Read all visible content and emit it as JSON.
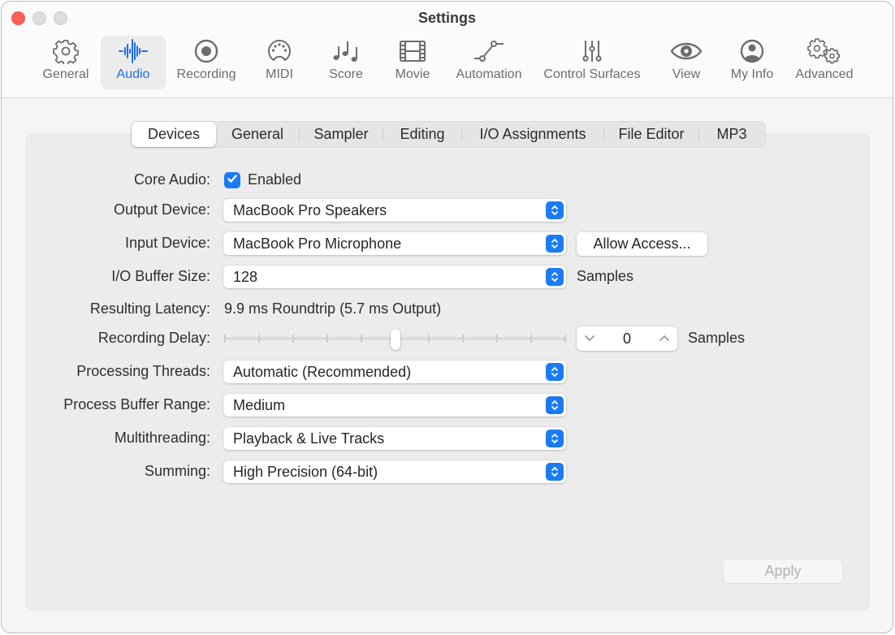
{
  "window": {
    "title": "Settings",
    "traffic_lights": [
      "close",
      "minimize",
      "zoom"
    ]
  },
  "toolbar": {
    "items": [
      {
        "label": "General",
        "icon": "gear-icon",
        "active": false
      },
      {
        "label": "Audio",
        "icon": "waveform-icon",
        "active": true
      },
      {
        "label": "Recording",
        "icon": "record-icon",
        "active": false
      },
      {
        "label": "MIDI",
        "icon": "midi-connector-icon",
        "active": false
      },
      {
        "label": "Score",
        "icon": "music-notes-icon",
        "active": false
      },
      {
        "label": "Movie",
        "icon": "film-icon",
        "active": false
      },
      {
        "label": "Automation",
        "icon": "automation-curve-icon",
        "active": false
      },
      {
        "label": "Control Surfaces",
        "icon": "sliders-icon",
        "active": false
      },
      {
        "label": "View",
        "icon": "eye-icon",
        "active": false
      },
      {
        "label": "My Info",
        "icon": "person-circle-icon",
        "active": false
      },
      {
        "label": "Advanced",
        "icon": "gears-icon",
        "active": false
      }
    ],
    "accent_color": "#1a6ff0"
  },
  "tabs": {
    "items": [
      "Devices",
      "General",
      "Sampler",
      "Editing",
      "I/O Assignments",
      "File Editor",
      "MP3"
    ],
    "active": "Devices"
  },
  "devices": {
    "core_audio": {
      "label": "Core Audio:",
      "checkbox_label": "Enabled",
      "checked": true
    },
    "output_device": {
      "label": "Output Device:",
      "value": "MacBook Pro Speakers"
    },
    "input_device": {
      "label": "Input Device:",
      "value": "MacBook Pro Microphone",
      "button": "Allow Access..."
    },
    "io_buffer_size": {
      "label": "I/O Buffer Size:",
      "value": "128",
      "unit": "Samples"
    },
    "resulting_latency": {
      "label": "Resulting Latency:",
      "value": "9.9 ms Roundtrip (5.7 ms Output)"
    },
    "recording_delay": {
      "label": "Recording Delay:",
      "slider_position": 0.5,
      "tick_count": 11,
      "value": "0",
      "unit": "Samples"
    },
    "processing_threads": {
      "label": "Processing Threads:",
      "value": "Automatic (Recommended)"
    },
    "process_buffer_range": {
      "label": "Process Buffer Range:",
      "value": "Medium"
    },
    "multithreading": {
      "label": "Multithreading:",
      "value": "Playback & Live Tracks"
    },
    "summing": {
      "label": "Summing:",
      "value": "High Precision (64-bit)"
    }
  },
  "footer": {
    "apply_label": "Apply",
    "apply_enabled": false
  },
  "colors": {
    "accent": "#1a7bf5",
    "close": "#fe5f57"
  }
}
